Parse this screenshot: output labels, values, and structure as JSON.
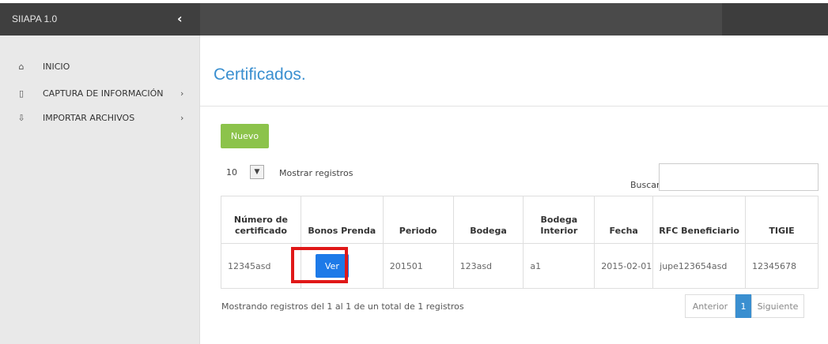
{
  "app": {
    "brand": "SIIAPA 1.0",
    "collapse_glyph": "‹"
  },
  "sidebar": {
    "items": [
      {
        "label": "INICIO",
        "icon": "home-icon",
        "glyph": "⌂",
        "chevron": ""
      },
      {
        "label": "CAPTURA DE INFORMACIÓN",
        "icon": "document-icon",
        "glyph": "▯",
        "chevron": "›"
      },
      {
        "label": "IMPORTAR ARCHIVOS",
        "icon": "download-icon",
        "glyph": "⇩",
        "chevron": "›"
      }
    ]
  },
  "main": {
    "title": "Certificados.",
    "new_button": "Nuevo",
    "length": {
      "value": "10",
      "arrow": "▼",
      "label": "Mostrar registros"
    },
    "search_label": "Buscar:",
    "search_value": "",
    "columns": [
      "Número de certificado",
      "Bonos Prenda",
      "Periodo",
      "Bodega",
      "Bodega Interior",
      "Fecha",
      "RFC Beneficiario",
      "TIGIE"
    ],
    "rows": [
      {
        "numero": "12345asd",
        "bonos_button": "Ver",
        "periodo": "201501",
        "bodega": "123asd",
        "bodega_interior": "a1",
        "fecha": "2015-02-01",
        "rfc": "jupe123654asd",
        "tigie": "12345678"
      }
    ],
    "info": "Mostrando registros del 1 al 1 de un total de 1 registros",
    "pagination": {
      "prev": "Anterior",
      "current": "1",
      "next": "Siguiente"
    }
  },
  "colors": {
    "accent": "#3a8fd0",
    "new_button": "#8cc34b",
    "view_button": "#1d7ae8",
    "highlight": "#e01818",
    "topbar": "#4a4a4a",
    "sidebar": "#e9e9e9"
  }
}
